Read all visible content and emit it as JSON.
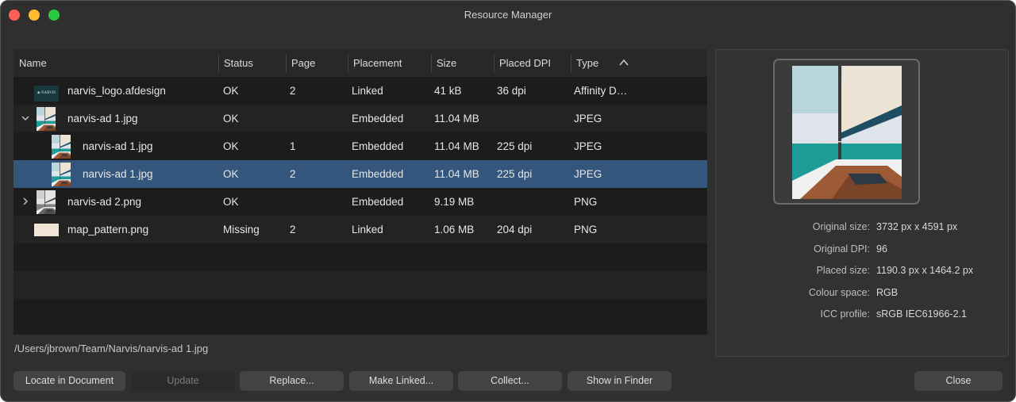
{
  "window": {
    "title": "Resource Manager"
  },
  "table": {
    "columns": [
      {
        "key": "name",
        "label": "Name"
      },
      {
        "key": "status",
        "label": "Status"
      },
      {
        "key": "page",
        "label": "Page"
      },
      {
        "key": "placement",
        "label": "Placement"
      },
      {
        "key": "size",
        "label": "Size"
      },
      {
        "key": "dpi",
        "label": "Placed DPI"
      },
      {
        "key": "type",
        "label": "Type"
      }
    ],
    "sort": {
      "column": "Type",
      "direction": "ascending",
      "icon": "chevron-up-icon"
    },
    "rows": [
      {
        "name": "narvis_logo.afdesign",
        "status": "OK",
        "page": "2",
        "placement": "Linked",
        "size": "41 kB",
        "dpi": "36 dpi",
        "type": "Affinity D…",
        "thumb": "logo",
        "indent": 0,
        "disclosure": "",
        "selected": false
      },
      {
        "name": "narvis-ad 1.jpg",
        "status": "OK",
        "page": "",
        "placement": "Embedded",
        "size": "11.04 MB",
        "dpi": "",
        "type": "JPEG",
        "thumb": "boat",
        "indent": 0,
        "disclosure": "expanded",
        "selected": false
      },
      {
        "name": "narvis-ad 1.jpg",
        "status": "OK",
        "page": "1",
        "placement": "Embedded",
        "size": "11.04 MB",
        "dpi": "225 dpi",
        "type": "JPEG",
        "thumb": "boat",
        "indent": 1,
        "disclosure": "",
        "selected": false
      },
      {
        "name": "narvis-ad 1.jpg",
        "status": "OK",
        "page": "2",
        "placement": "Embedded",
        "size": "11.04 MB",
        "dpi": "225 dpi",
        "type": "JPEG",
        "thumb": "boat",
        "indent": 1,
        "disclosure": "",
        "selected": true
      },
      {
        "name": "narvis-ad 2.png",
        "status": "OK",
        "page": "",
        "placement": "Embedded",
        "size": "9.19 MB",
        "dpi": "",
        "type": "PNG",
        "thumb": "boat-bw",
        "indent": 0,
        "disclosure": "collapsed",
        "selected": false
      },
      {
        "name": "map_pattern.png",
        "status": "Missing",
        "page": "2",
        "placement": "Linked",
        "size": "1.06 MB",
        "dpi": "204 dpi",
        "type": "PNG",
        "thumb": "pattern",
        "indent": 0,
        "disclosure": "",
        "selected": false
      }
    ],
    "logo_thumb_text": "NARVIS"
  },
  "path": "/Users/jbrown/Team/Narvis/narvis-ad 1.jpg",
  "buttons": {
    "locate": "Locate in Document",
    "update": "Update",
    "replace": "Replace...",
    "make_linked": "Make Linked...",
    "collect": "Collect...",
    "show_in_finder": "Show in Finder",
    "close": "Close"
  },
  "details": [
    {
      "label": "Original size:",
      "value": "3732 px x 4591 px"
    },
    {
      "label": "Original DPI:",
      "value": "96"
    },
    {
      "label": "Placed size:",
      "value": "1190.3 px x 1464.2 px"
    },
    {
      "label": "Colour space:",
      "value": "RGB"
    },
    {
      "label": "ICC profile:",
      "value": "sRGB IEC61966-2.1"
    }
  ],
  "colors": {
    "selection": "#35567c",
    "window_bg": "#2f2f2f",
    "table_bg": "#1c1c1c"
  }
}
